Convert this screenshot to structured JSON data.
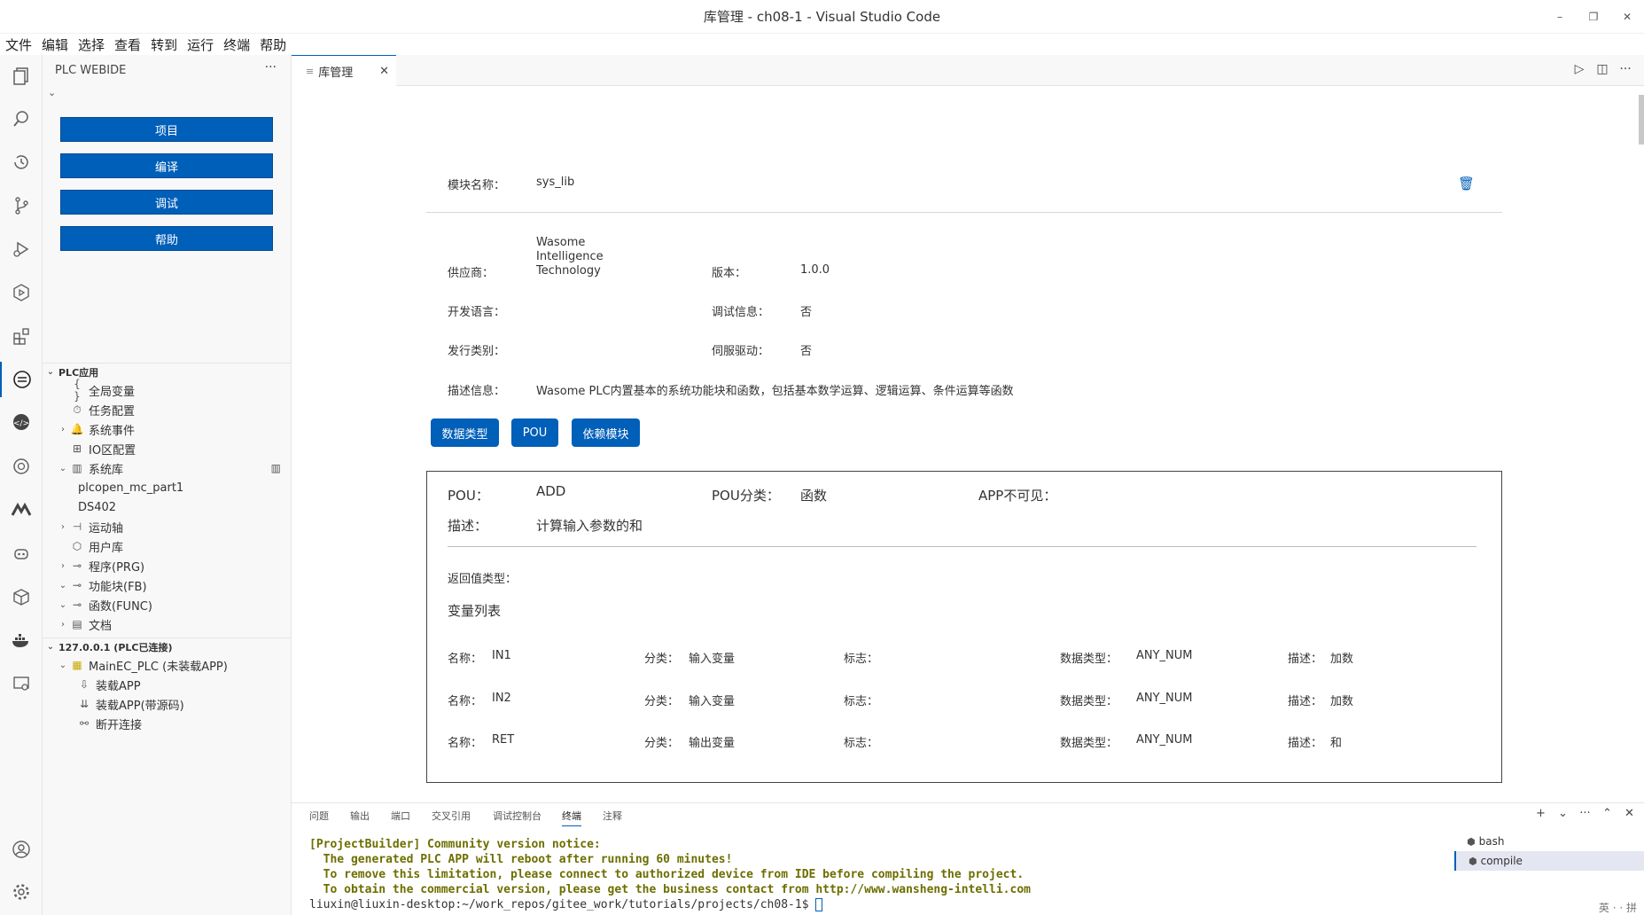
{
  "window": {
    "title": "库管理 - ch08-1 - Visual Studio Code",
    "controls": {
      "minimize": "–",
      "restore": "❐",
      "close": "✕"
    }
  },
  "menu": [
    "文件",
    "编辑",
    "选择",
    "查看",
    "转到",
    "运行",
    "终端",
    "帮助"
  ],
  "sidebar": {
    "title": "PLC WEBIDE",
    "more": "···",
    "buttons": [
      "项目",
      "编译",
      "调试",
      "帮助"
    ],
    "plc_app": {
      "header": "PLC应用",
      "items": [
        {
          "label": "全局变量",
          "icon": "{ }"
        },
        {
          "label": "任务配置",
          "icon": "⏱"
        },
        {
          "label": "系统事件",
          "icon": "🔔"
        },
        {
          "label": "IO区配置",
          "icon": "⊞"
        },
        {
          "label": "系统库",
          "icon": "▥"
        },
        {
          "label": "plcopen_mc_part1"
        },
        {
          "label": "DS402"
        },
        {
          "label": "运动轴",
          "icon": "⊣"
        },
        {
          "label": "用户库",
          "icon": "⬡"
        },
        {
          "label": "程序(PRG)",
          "icon": "⊸"
        },
        {
          "label": "功能块(FB)",
          "icon": "⊸"
        },
        {
          "label": "函数(FUNC)",
          "icon": "⊸"
        },
        {
          "label": "文档",
          "icon": "▤"
        }
      ],
      "syslib_action": "▥"
    },
    "connection": {
      "header": "127.0.0.1 (PLC已连接)",
      "items": [
        {
          "label": "MainEC_PLC (未装载APP)",
          "icon": "▦"
        },
        {
          "label": "装载APP",
          "icon": "⇩"
        },
        {
          "label": "装载APP(带源码)",
          "icon": "⇊"
        },
        {
          "label": "断开连接",
          "icon": "⚯"
        }
      ]
    }
  },
  "tab": {
    "label": "库管理",
    "icon": "≡",
    "close": "✕"
  },
  "editor_actions": [
    "▷",
    "◫",
    "···"
  ],
  "module": {
    "name_label": "模块名称：",
    "name_value": "sys_lib",
    "delete_icon": "🗑",
    "vendor_label": "供应商：",
    "vendor_value": [
      "Wasome",
      "Intelligence",
      "Technology"
    ],
    "version_label": "版本：",
    "version_value": "1.0.0",
    "lang_label": "开发语言：",
    "debug_label": "调试信息：",
    "debug_value": "否",
    "release_label": "发行类别：",
    "servo_label": "伺服驱动：",
    "servo_value": "否",
    "desc_label": "描述信息：",
    "desc_value": "Wasome PLC内置基本的系统功能块和函数，包括基本数学运算、逻辑运算、条件运算等函数"
  },
  "tabs_buttons": [
    "数据类型",
    "POU",
    "依赖模块"
  ],
  "pou": {
    "pou_label": "POU：",
    "pou_value": "ADD",
    "class_label": "POU分类：",
    "class_value": "函数",
    "hidden_label": "APP不可见：",
    "desc_label": "描述：",
    "desc_value": "计算输入参数的和",
    "return_label": "返回值类型：",
    "var_list_title": "变量列表",
    "col_labels": {
      "name": "名称：",
      "category": "分类：",
      "flag": "标志：",
      "type": "数据类型：",
      "desc": "描述："
    },
    "variables": [
      {
        "name": "IN1",
        "category": "输入变量",
        "type": "ANY_NUM",
        "desc": "加数"
      },
      {
        "name": "IN2",
        "category": "输入变量",
        "type": "ANY_NUM",
        "desc": "加数"
      },
      {
        "name": "RET",
        "category": "输出变量",
        "type": "ANY_NUM",
        "desc": "和"
      }
    ]
  },
  "panel": {
    "tabs": [
      "问题",
      "输出",
      "端口",
      "交叉引用",
      "调试控制台",
      "终端",
      "注释"
    ],
    "active_tab": "终端",
    "actions": [
      "+",
      "⌄",
      "···",
      "⌃",
      "✕"
    ],
    "terminal_lines": [
      "[ProjectBuilder] Community version notice:",
      "  The generated PLC APP will reboot after running 60 minutes!",
      "  To remove this limitation, please connect to authorized device from IDE before compiling the project.",
      "  To obtain the commercial version, please get the business contact from http://www.wansheng-intelli.com"
    ],
    "prompt": "liuxin@liuxin-desktop:~/work_repos/gitee_work/tutorials/projects/ch08-1$",
    "terminals": [
      "bash",
      "compile"
    ],
    "ime": "英 · · 拼"
  },
  "colors": {
    "accent": "#005fb8",
    "warn_text": "#6e6e00"
  }
}
